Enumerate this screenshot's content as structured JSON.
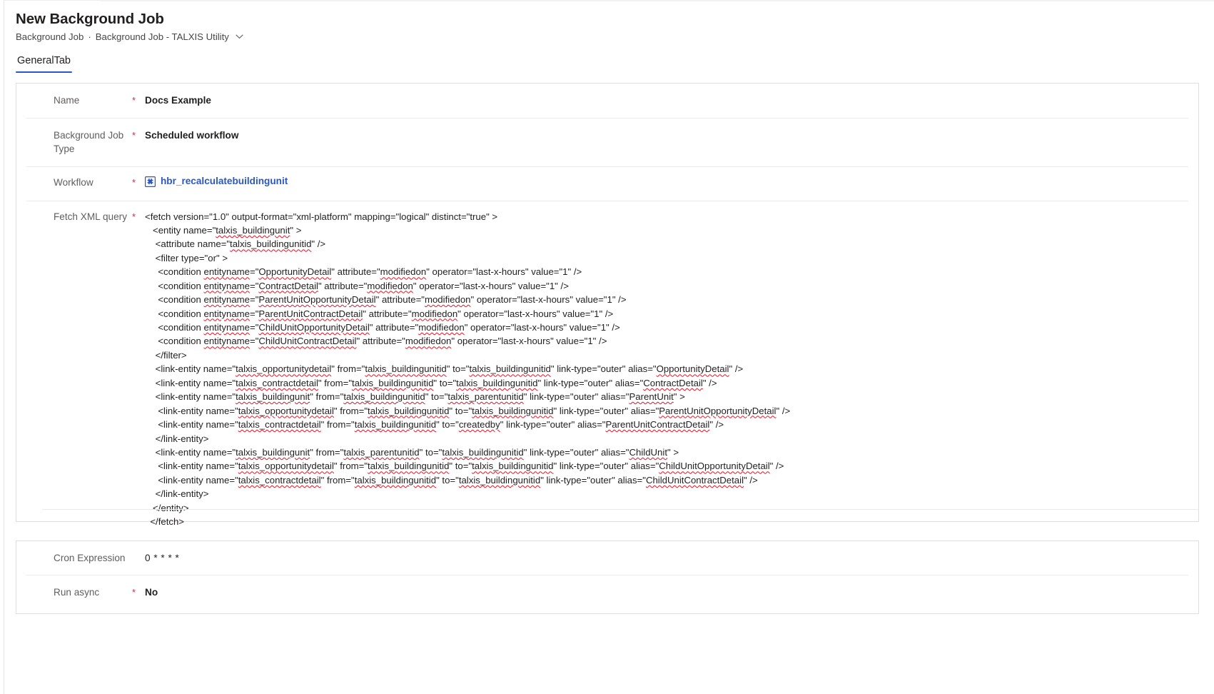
{
  "header": {
    "title": "New Background Job",
    "breadcrumb": {
      "parent": "Background Job",
      "separator": "·",
      "current": "Background Job - TALXIS Utility",
      "chevron_icon": "chevron-down-icon"
    }
  },
  "tabs": [
    {
      "label": "GeneralTab",
      "active": true
    }
  ],
  "accent_color": "#2b57c4",
  "required_marker": "*",
  "form": {
    "fields": [
      {
        "label": "Name",
        "required": true,
        "value": "Docs Example",
        "type": "text"
      },
      {
        "label": "Background Job Type",
        "required": true,
        "value": "Scheduled workflow",
        "type": "choice"
      },
      {
        "label": "Workflow",
        "required": true,
        "value": "hbr_recalculatebuildingunit",
        "type": "lookup",
        "icon": "workflow-process-icon",
        "link_color": "#2b57c4"
      },
      {
        "label": "Fetch XML query",
        "required": true,
        "type": "multiline",
        "value_lines": [
          "<fetch version=\"1.0\" output-format=\"xml-platform\" mapping=\"logical\" distinct=\"true\" >",
          "   <entity name=\"talxis_buildingunit\" >",
          "    <attribute name=\"talxis_buildingunitid\" />",
          "    <filter type=\"or\" >",
          "     <condition entityname=\"OpportunityDetail\" attribute=\"modifiedon\" operator=\"last-x-hours\" value=\"1\" />",
          "     <condition entityname=\"ContractDetail\" attribute=\"modifiedon\" operator=\"last-x-hours\" value=\"1\" />",
          "     <condition entityname=\"ParentUnitOpportunityDetail\" attribute=\"modifiedon\" operator=\"last-x-hours\" value=\"1\" />",
          "     <condition entityname=\"ParentUnitContractDetail\" attribute=\"modifiedon\" operator=\"last-x-hours\" value=\"1\" />",
          "     <condition entityname=\"ChildUnitOpportunityDetail\" attribute=\"modifiedon\" operator=\"last-x-hours\" value=\"1\" />",
          "     <condition entityname=\"ChildUnitContractDetail\" attribute=\"modifiedon\" operator=\"last-x-hours\" value=\"1\" />",
          "    </filter>",
          "    <link-entity name=\"talxis_opportunitydetail\" from=\"talxis_buildingunitid\" to=\"talxis_buildingunitid\" link-type=\"outer\" alias=\"OpportunityDetail\" />",
          "    <link-entity name=\"talxis_contractdetail\" from=\"talxis_buildingunitid\" to=\"talxis_buildingunitid\" link-type=\"outer\" alias=\"ContractDetail\" />",
          "    <link-entity name=\"talxis_buildingunit\" from=\"talxis_buildingunitid\" to=\"talxis_parentunitid\" link-type=\"outer\" alias=\"ParentUnit\" >",
          "     <link-entity name=\"talxis_opportunitydetail\" from=\"talxis_buildingunitid\" to=\"talxis_buildingunitid\" link-type=\"outer\" alias=\"ParentUnitOpportunityDetail\" />",
          "     <link-entity name=\"talxis_contractdetail\" from=\"talxis_buildingunitid\" to=\"createdby\" link-type=\"outer\" alias=\"ParentUnitContractDetail\" />",
          "    </link-entity>",
          "    <link-entity name=\"talxis_buildingunit\" from=\"talxis_parentunitid\" to=\"talxis_buildingunitid\" link-type=\"outer\" alias=\"ChildUnit\" >",
          "     <link-entity name=\"talxis_opportunitydetail\" from=\"talxis_buildingunitid\" to=\"talxis_buildingunitid\" link-type=\"outer\" alias=\"ChildUnitOpportunityDetail\" />",
          "     <link-entity name=\"talxis_contractdetail\" from=\"talxis_buildingunitid\" to=\"talxis_buildingunitid\" link-type=\"outer\" alias=\"ChildUnitContractDetail\" />",
          "    </link-entity>",
          "   </entity>",
          "  </fetch>"
        ]
      }
    ]
  },
  "form_bottom": {
    "fields": [
      {
        "label": "Cron Expression",
        "required": false,
        "value": "0 * * * *",
        "type": "text"
      },
      {
        "label": "Run async",
        "required": true,
        "value": "No",
        "type": "boolean"
      }
    ]
  },
  "spellcheck_words": [
    "talxis_buildingunit",
    "talxis_buildingunitid",
    "entityname",
    "OpportunityDetail",
    "modifiedon",
    "ContractDetail",
    "ParentUnitOpportunityDetail",
    "ParentUnitContractDetail",
    "ChildUnitOpportunityDetail",
    "ChildUnitContractDetail",
    "talxis_opportunitydetail",
    "talxis_contractdetail",
    "talxis_parentunitid",
    "ParentUnit",
    "ChildUnit",
    "createdby"
  ]
}
